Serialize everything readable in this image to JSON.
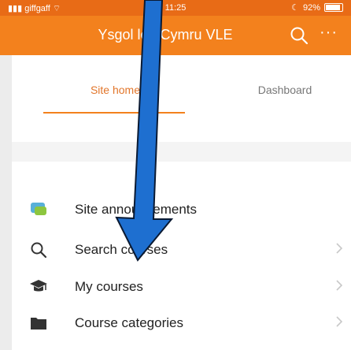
{
  "status": {
    "carrier": "giffgaff",
    "time": "11:25",
    "battery": "92%",
    "battery_level": 0.92
  },
  "header": {
    "title": "Ysgol lon Cymru VLE"
  },
  "tabs": [
    {
      "label": "Site home",
      "active": true
    },
    {
      "label": "Dashboard",
      "active": false
    }
  ],
  "menu": {
    "items": [
      {
        "label": "Site announcements",
        "icon": "announcements-icon"
      },
      {
        "label": "Search courses",
        "icon": "search-icon"
      },
      {
        "label": "My courses",
        "icon": "graduation-cap-icon"
      },
      {
        "label": "Course categories",
        "icon": "folder-icon"
      }
    ]
  },
  "colors": {
    "accent": "#f3811d",
    "status_bar": "#e86b16",
    "arrow": "#1e6fd0",
    "active_tab_text": "#e2762b"
  }
}
